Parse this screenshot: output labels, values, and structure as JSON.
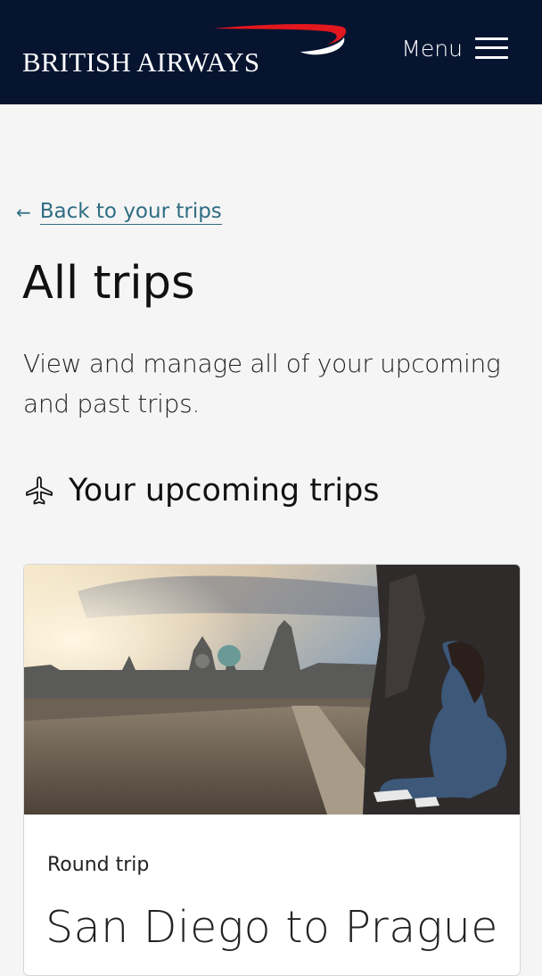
{
  "header": {
    "brand": "BRITISH AIRWAYS",
    "menu_label": "Menu"
  },
  "nav": {
    "back_label": "Back to your trips"
  },
  "main": {
    "title": "All trips",
    "description": "View and manage all of your upcoming and past trips.",
    "section_heading": "Your upcoming trips"
  },
  "trips": [
    {
      "type": "Round trip",
      "route": "San Diego to Prague"
    }
  ],
  "colors": {
    "header_bg": "#061430",
    "brand_red": "#e3171e",
    "link": "#2f6d83",
    "page_bg": "#f5f5f5"
  },
  "icons": {
    "back": "arrow-left-icon",
    "menu": "hamburger-icon",
    "section": "plane-icon"
  }
}
